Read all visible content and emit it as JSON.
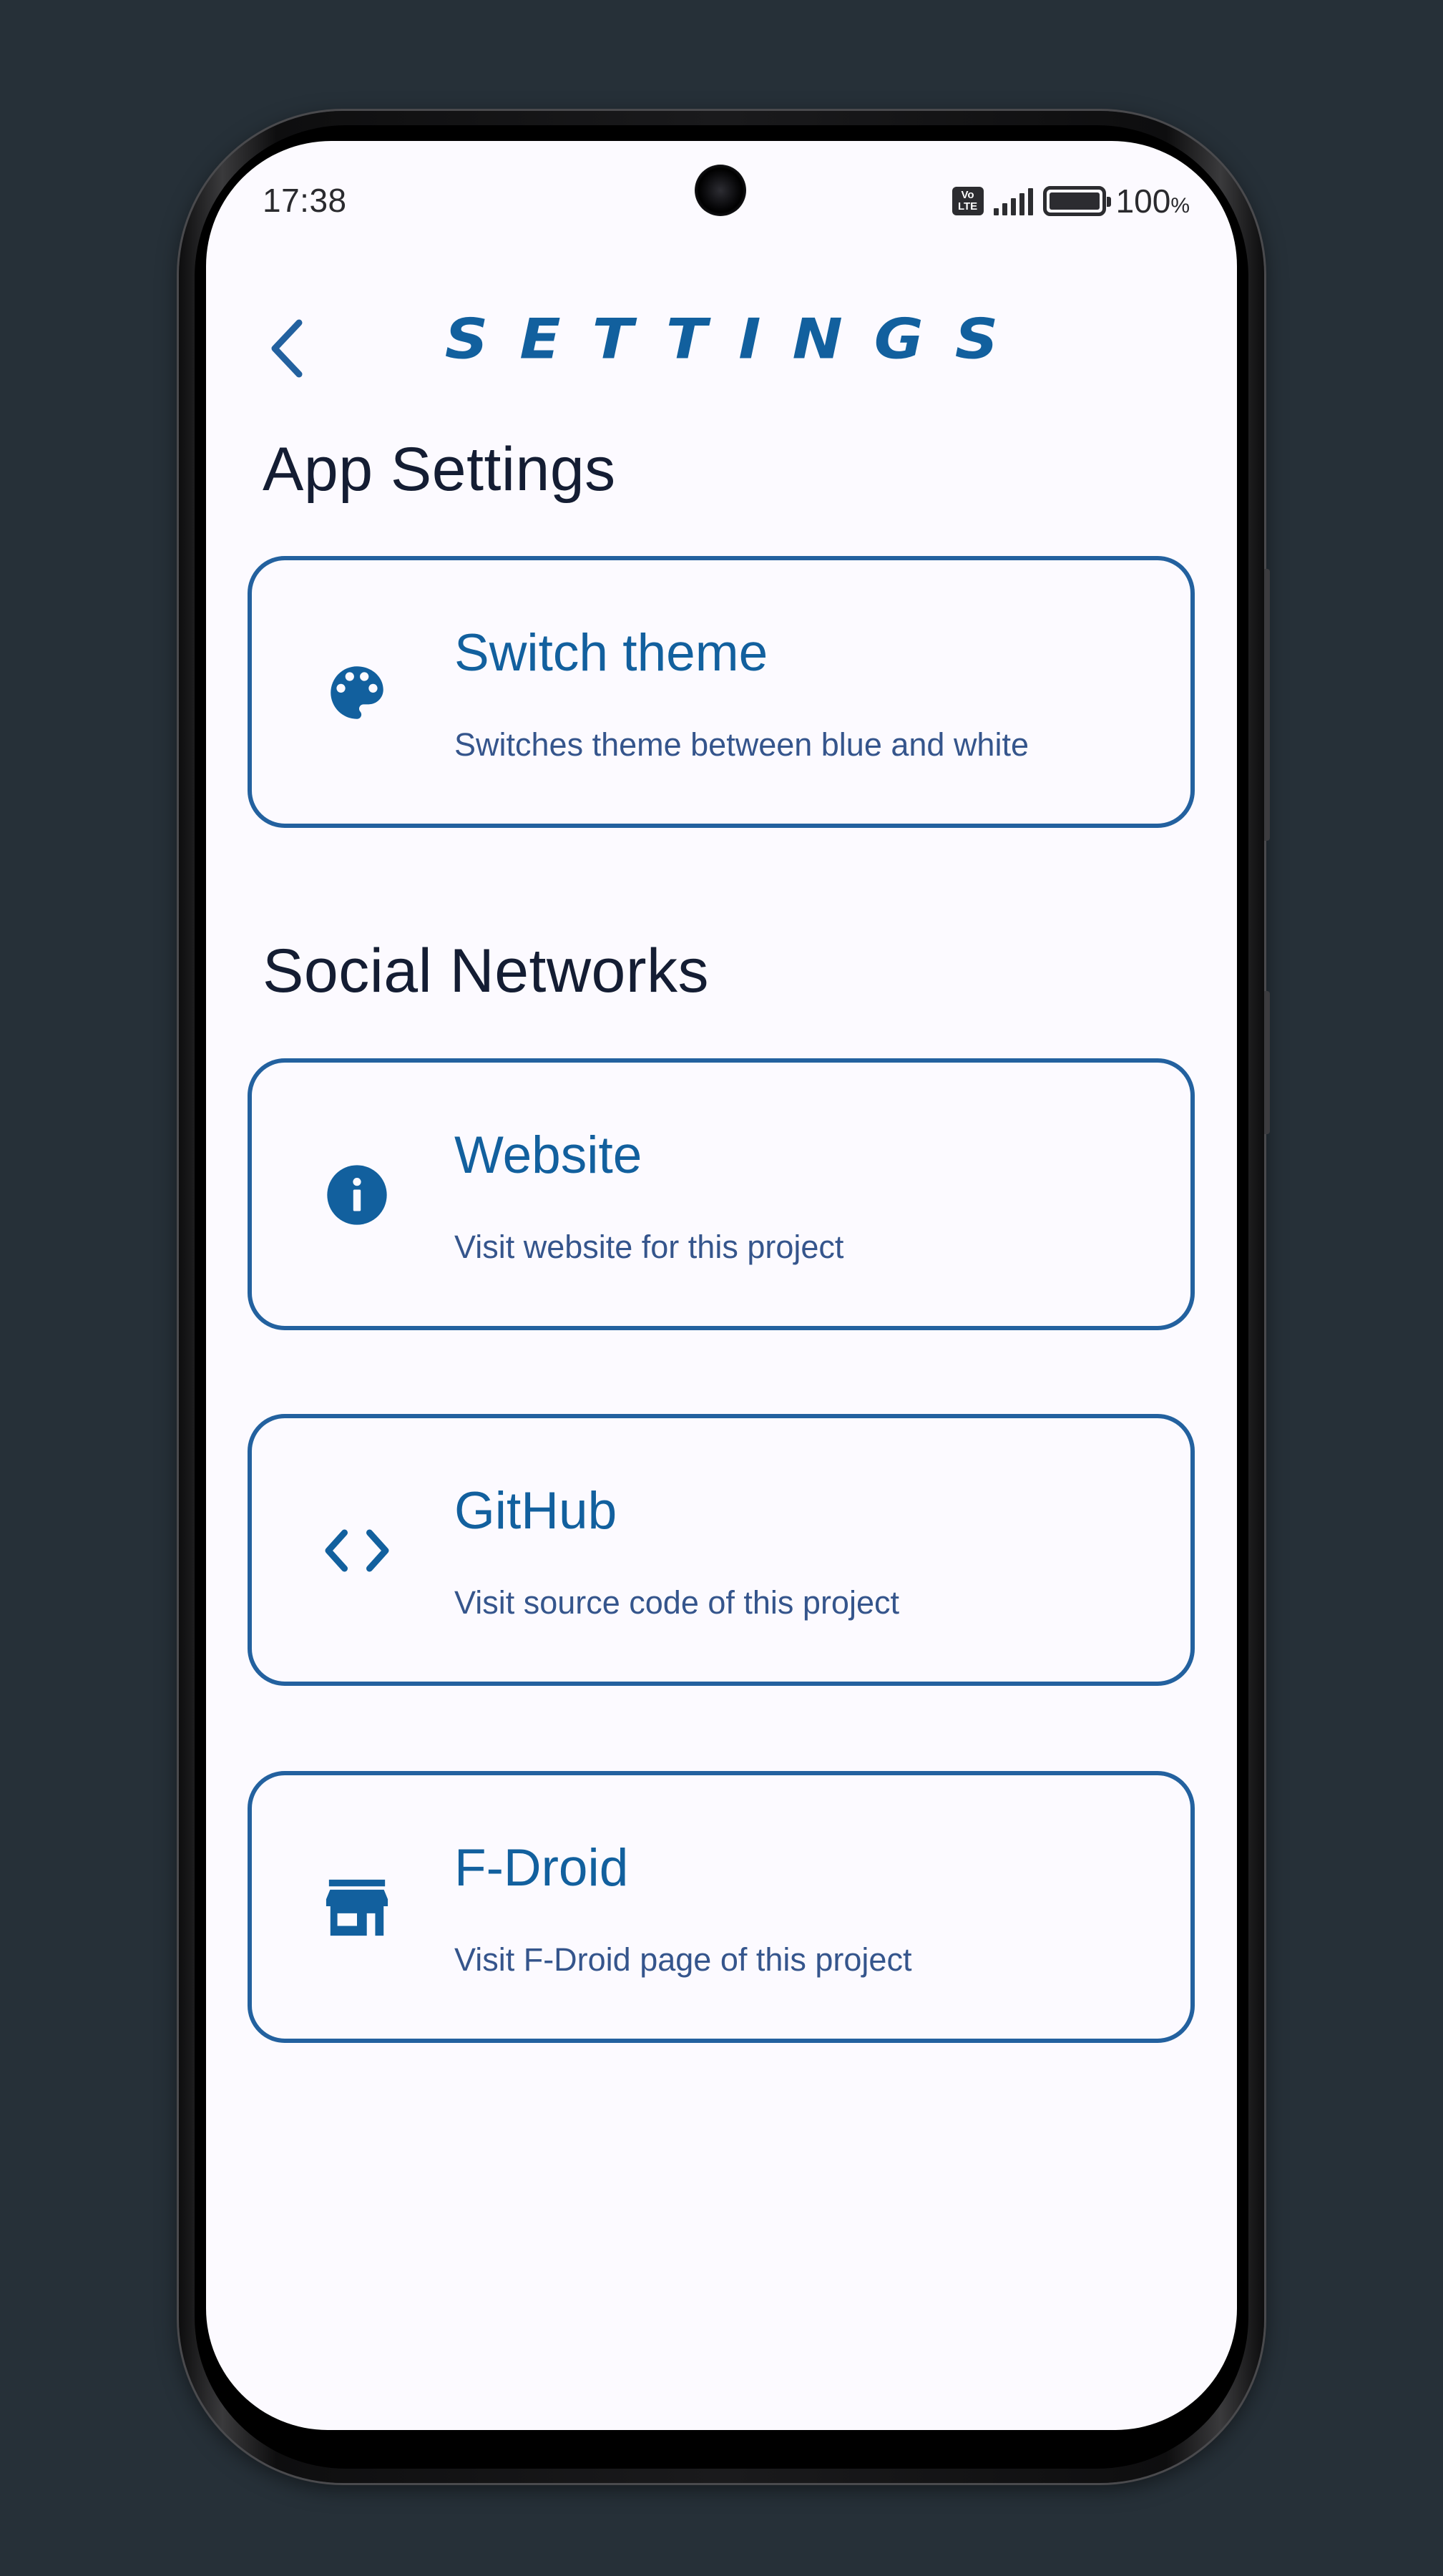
{
  "status_bar": {
    "time": "17:38",
    "volte_top": "Vo",
    "volte_bottom": "LTE",
    "battery_value": "100",
    "battery_unit": "%"
  },
  "header": {
    "title": "SETTINGS",
    "back_icon": "chevron-left-icon"
  },
  "sections": {
    "app_settings": "App Settings",
    "social_networks": "Social Networks"
  },
  "cards": {
    "theme": {
      "icon": "palette-icon",
      "title": "Switch theme",
      "subtitle": "Switches theme between blue and white"
    },
    "website": {
      "icon": "info-icon",
      "title": "Website",
      "subtitle": "Visit website for this project"
    },
    "github": {
      "icon": "code-icon",
      "title": "GitHub",
      "subtitle": "Visit source code of this project"
    },
    "fdroid": {
      "icon": "storefront-icon",
      "title": "F-Droid",
      "subtitle": "Visit F-Droid page of this project"
    }
  },
  "colors": {
    "background": "#263038",
    "screen": "#fcfaff",
    "accent": "#12609e",
    "card_border": "#23619f",
    "heading_text": "#141d33",
    "subtitle_text": "#35558c"
  }
}
